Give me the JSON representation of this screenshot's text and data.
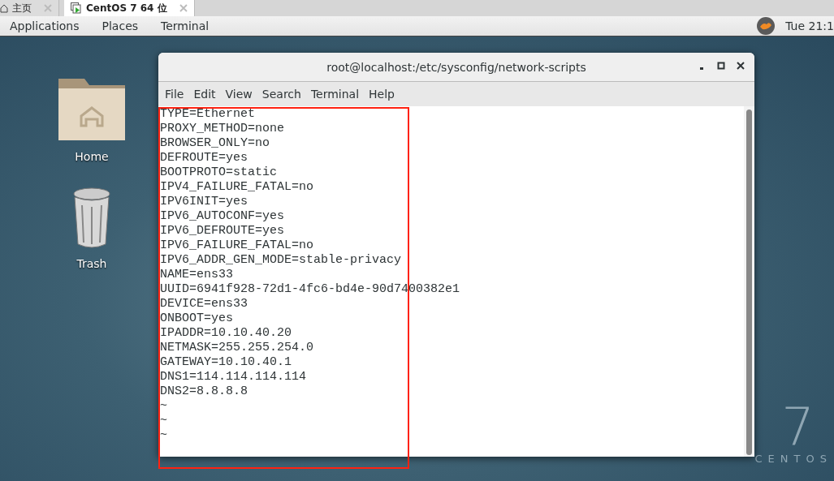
{
  "vm_tabs": [
    {
      "label": "主页",
      "selected": false,
      "kind": "home"
    },
    {
      "label": "CentOS 7 64 位",
      "selected": true,
      "kind": "vm"
    }
  ],
  "top_bar": {
    "menus": [
      "Applications",
      "Places",
      "Terminal"
    ],
    "clock": "Tue 21:1"
  },
  "desktop_icons": [
    {
      "label": "Home",
      "kind": "folder"
    },
    {
      "label": "Trash",
      "kind": "trash"
    }
  ],
  "terminal": {
    "title": "root@localhost:/etc/sysconfig/network-scripts",
    "menu": [
      "File",
      "Edit",
      "View",
      "Search",
      "Terminal",
      "Help"
    ],
    "lines": [
      "TYPE=Ethernet",
      "PROXY_METHOD=none",
      "BROWSER_ONLY=no",
      "DEFROUTE=yes",
      "BOOTPROTO=static",
      "IPV4_FAILURE_FATAL=no",
      "IPV6INIT=yes",
      "IPV6_AUTOCONF=yes",
      "IPV6_DEFROUTE=yes",
      "IPV6_FAILURE_FATAL=no",
      "IPV6_ADDR_GEN_MODE=stable-privacy",
      "NAME=ens33",
      "UUID=6941f928-72d1-4fc6-bd4e-90d7400382e1",
      "DEVICE=ens33",
      "ONBOOT=yes",
      "IPADDR=10.10.40.20",
      "NETMASK=255.255.254.0",
      "GATEWAY=10.10.40.1",
      "DNS1=114.114.114.114",
      "DNS2=8.8.8.8",
      "~",
      "~",
      "~"
    ]
  },
  "branding": {
    "version": "7",
    "name": "CENTOS"
  }
}
